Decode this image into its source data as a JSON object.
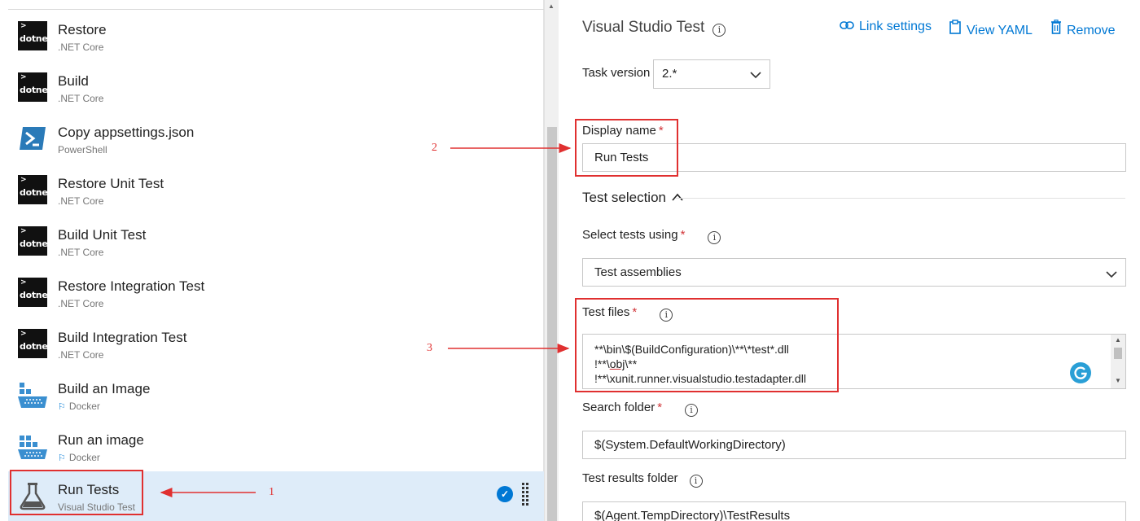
{
  "tasks": [
    {
      "name": "Restore",
      "subtitle": ".NET Core",
      "icon": "dotnet-icon",
      "icon_text": "dotnet"
    },
    {
      "name": "Build",
      "subtitle": ".NET Core",
      "icon": "dotnet-icon",
      "icon_text": "dotnet"
    },
    {
      "name": "Copy appsettings.json",
      "subtitle": "PowerShell",
      "icon": "powershell-icon"
    },
    {
      "name": "Restore Unit Test",
      "subtitle": ".NET Core",
      "icon": "dotnet-icon",
      "icon_text": "dotnet"
    },
    {
      "name": "Build Unit Test",
      "subtitle": ".NET Core",
      "icon": "dotnet-icon",
      "icon_text": "dotnet"
    },
    {
      "name": "Restore Integration Test",
      "subtitle": ".NET Core",
      "icon": "dotnet-icon",
      "icon_text": "dotnet"
    },
    {
      "name": "Build Integration Test",
      "subtitle": ".NET Core",
      "icon": "dotnet-icon",
      "icon_text": "dotnet"
    },
    {
      "name": "Build an Image",
      "subtitle": "Docker",
      "icon": "docker-icon"
    },
    {
      "name": "Run an image",
      "subtitle": "Docker",
      "icon": "docker-icon"
    },
    {
      "name": "Run Tests",
      "subtitle": "Visual Studio Test",
      "icon": "flask-icon",
      "selected": true
    }
  ],
  "panel": {
    "title": "Visual Studio Test",
    "actions": {
      "link_settings": "Link settings",
      "view_yaml": "View YAML",
      "remove": "Remove"
    },
    "task_version_label": "Task version",
    "task_version_value": "2.*",
    "display_name_label": "Display name",
    "display_name_value": "Run Tests",
    "section_test_selection": "Test selection",
    "select_tests_label": "Select tests using",
    "select_tests_value": "Test assemblies",
    "test_files_label": "Test files",
    "test_files_lines": [
      "**\\bin\\$(BuildConfiguration)\\**\\*test*.dll",
      "!**\\obj\\**",
      "!**\\xunit.runner.visualstudio.testadapter.dll"
    ],
    "search_folder_label": "Search folder",
    "search_folder_value": "$(System.DefaultWorkingDirectory)",
    "results_folder_label": "Test results folder",
    "results_folder_value": "$(Agent.TempDirectory)\\TestResults",
    "required_mark": "*",
    "info_glyph": "i"
  },
  "annotations": {
    "one": "1",
    "two": "2",
    "three": "3",
    "color": "#e03030"
  },
  "colors": {
    "accent": "#0078d4",
    "selected_row": "#deecf9",
    "required": "#d13438"
  }
}
